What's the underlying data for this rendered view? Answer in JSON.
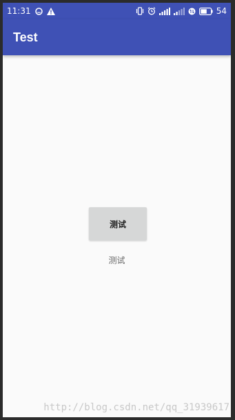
{
  "status_bar": {
    "time": "11:31",
    "battery": "54",
    "icons": [
      "circle-app-icon",
      "warning-icon",
      "vibrate-icon",
      "alarm-icon",
      "signal-icon",
      "signal-2-icon",
      "data-icon",
      "battery-icon"
    ]
  },
  "app_bar": {
    "title": "Test"
  },
  "content": {
    "button_label": "测试",
    "text_label": "测试"
  },
  "watermark": "http://blog.csdn.net/qq_31939617",
  "colors": {
    "primary": "#3f51b5",
    "background": "#fafafa",
    "button": "#d6d7d7"
  }
}
